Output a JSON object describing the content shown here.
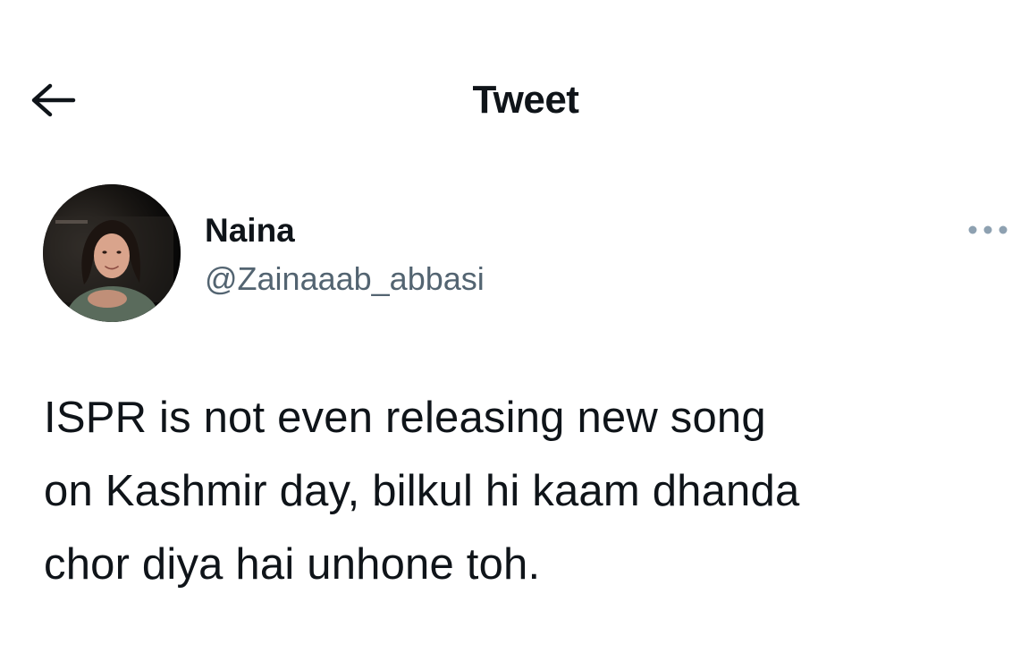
{
  "header": {
    "title": "Tweet",
    "back_icon": "arrow-left-icon"
  },
  "tweet": {
    "author": {
      "display_name": "Naina",
      "username": "@Zainaaab_abbasi",
      "avatar": "profile-photo"
    },
    "more_icon": "more-horizontal-icon",
    "text_lines": [
      "ISPR is not even releasing new song",
      "on Kashmir day, bilkul hi kaam dhanda",
      "chor diya hai unhone toh."
    ]
  },
  "colors": {
    "text_primary": "#0f1419",
    "text_secondary": "#536471",
    "icon_muted": "#8ea1b1",
    "background": "#ffffff"
  }
}
